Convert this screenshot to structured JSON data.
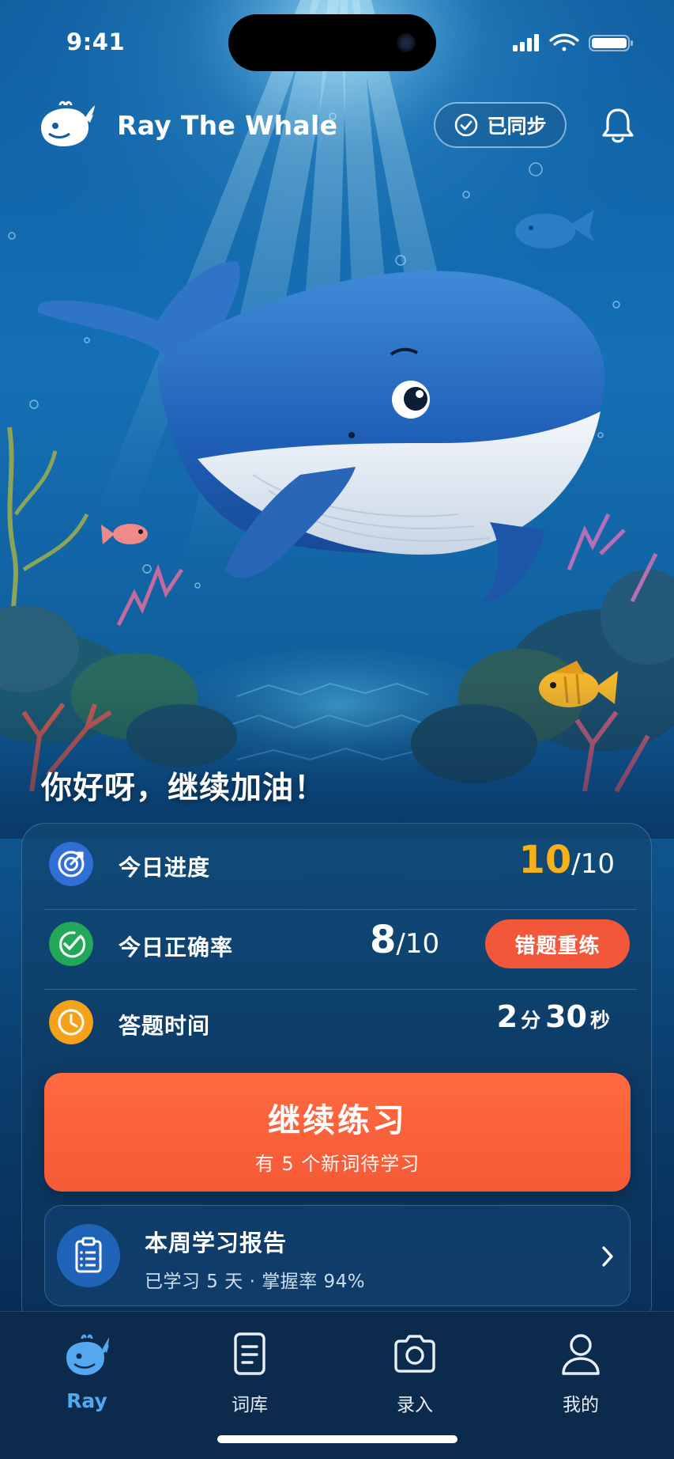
{
  "status_bar": {
    "time": "9:41"
  },
  "header": {
    "app_title": "Ray The Whale",
    "sync_label": "已同步"
  },
  "greeting": "你好呀，继续加油！",
  "stats": {
    "progress": {
      "label": "今日进度",
      "value": "10",
      "total": "/10"
    },
    "accuracy": {
      "label": "今日正确率",
      "value": "8",
      "total": "/10",
      "retry_label": "错题重练"
    },
    "time": {
      "label": "答题时间",
      "minutes": "2",
      "minutes_unit": "分",
      "seconds": "30",
      "seconds_unit": "秒"
    }
  },
  "cta": {
    "title": "继续练习",
    "subtitle": "有 5 个新词待学习"
  },
  "report": {
    "title": "本周学习报告",
    "subtitle": "已学习 5 天 · 掌握率 94%"
  },
  "tabs": [
    {
      "label": "Ray",
      "icon": "whale-icon",
      "active": true
    },
    {
      "label": "词库",
      "icon": "document-icon",
      "active": false
    },
    {
      "label": "录入",
      "icon": "camera-icon",
      "active": false
    },
    {
      "label": "我的",
      "icon": "person-icon",
      "active": false
    }
  ],
  "colors": {
    "accent_orange": "#f45a36",
    "gold": "#f7b019",
    "active_tab": "#53a8f0",
    "progress_icon": "#2f6fd6",
    "accuracy_icon": "#23a85a",
    "time_icon": "#f4a21a"
  }
}
